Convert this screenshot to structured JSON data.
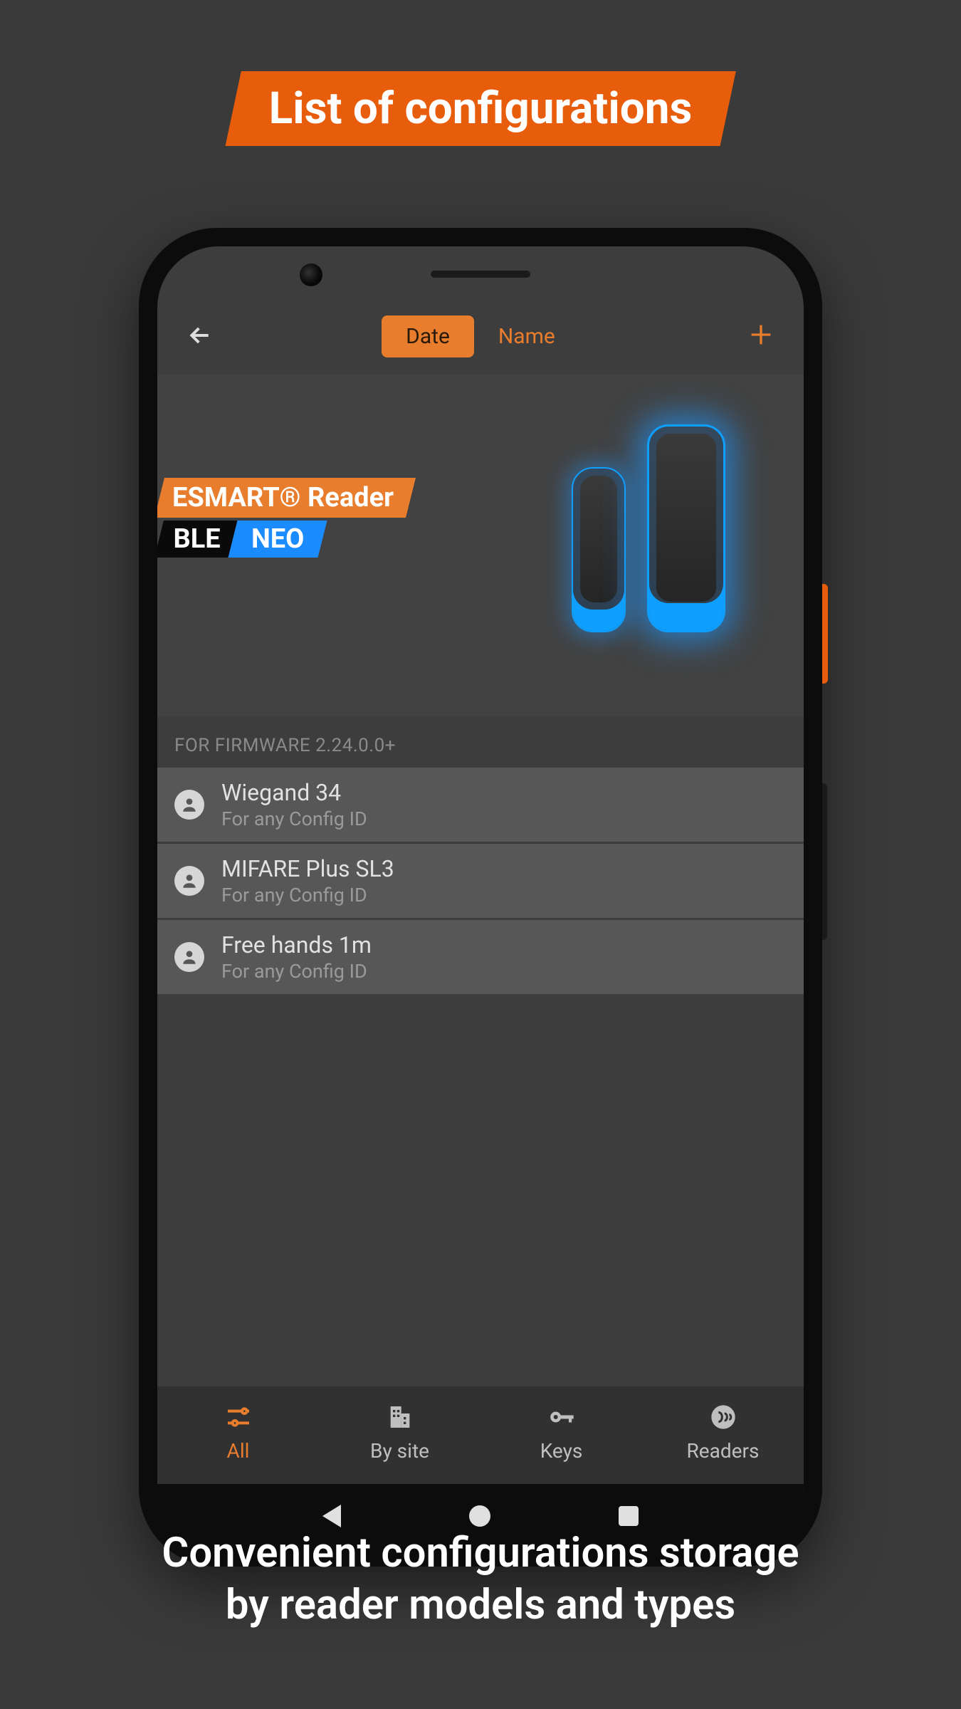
{
  "banner": {
    "title": "List of configurations"
  },
  "header": {
    "sort_options": {
      "date": "Date",
      "name": "Name"
    }
  },
  "hero": {
    "brand": "ESMART® Reader",
    "badge_ble": "BLE",
    "badge_neo": "NEO"
  },
  "section": {
    "firmware_header": "FOR FIRMWARE 2.24.0.0+"
  },
  "configs": [
    {
      "title": "Wiegand 34",
      "subtitle": "For any Config ID"
    },
    {
      "title": "MIFARE Plus SL3",
      "subtitle": "For any Config ID"
    },
    {
      "title": "Free hands 1m",
      "subtitle": "For any Config ID"
    }
  ],
  "nav": {
    "all": "All",
    "by_site": "By site",
    "keys": "Keys",
    "readers": "Readers"
  },
  "footer": {
    "line1": "Convenient configurations storage",
    "line2": "by reader models and types"
  }
}
